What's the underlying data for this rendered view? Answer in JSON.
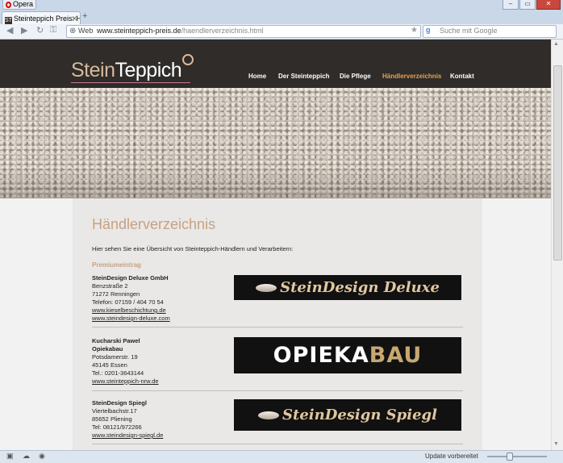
{
  "browser": {
    "menu_label": "Opera",
    "tab_title": "Steinteppich Preis: Hän...",
    "tab_favicon_text": "ST",
    "address_mode": "Web",
    "url_domain": "www.steinteppich-preis.de",
    "url_path": "/haendlerverzeichnis.html",
    "search_placeholder": "Suche mit Google",
    "search_engine_glyph": "g",
    "status_text": "Update vorbereitet"
  },
  "site": {
    "logo_part1": "Stein",
    "logo_part2": "Teppich",
    "colors": {
      "header_bg": "#2f2c2a",
      "accent": "#c7a27e",
      "active_nav": "#e8a04e"
    },
    "nav": [
      {
        "label": "Home",
        "active": false
      },
      {
        "label": "Der Steinteppich",
        "active": false
      },
      {
        "label": "Die Pflege",
        "active": false
      },
      {
        "label": "Händlerverzeichnis",
        "active": true
      },
      {
        "label": "Kontakt",
        "active": false
      }
    ]
  },
  "main": {
    "heading": "Händlerverzeichnis",
    "intro": "Hier sehen Sie eine Übersicht von Steinteppich-Händlern und Verarbeitern:",
    "premium_label": "Premiumeintrag",
    "dealers": [
      {
        "lines": [
          "SteinDesign Deluxe GmbH",
          "Benzstraße 2",
          "71272 Renningen",
          "Telefon: 07159 / 404 70 54"
        ],
        "bold_lines": 1,
        "links": [
          "www.kieselbeschichtung.de",
          "www.steindesign-deluxe.com"
        ],
        "banner_text": "SteinDesign Deluxe"
      },
      {
        "lines": [
          "Kucharski Pawel",
          "Opiekabau",
          "Potsdamerstr. 19",
          "45145 Essen",
          "Tel.: 0201-3643144"
        ],
        "bold_lines": 2,
        "links": [
          "www.steinteppich-nrw.de"
        ],
        "banner_text_1": "OPIEKA",
        "banner_text_2": "BAU"
      },
      {
        "lines": [
          "SteinDesign Spiegl",
          "Viertelbachstr.17",
          "85652 Pliening",
          "Tel: 08121/972266"
        ],
        "bold_lines": 1,
        "links": [
          "www.steindesign-spiegl.de"
        ],
        "banner_text": "SteinDesign Spiegl"
      }
    ]
  }
}
